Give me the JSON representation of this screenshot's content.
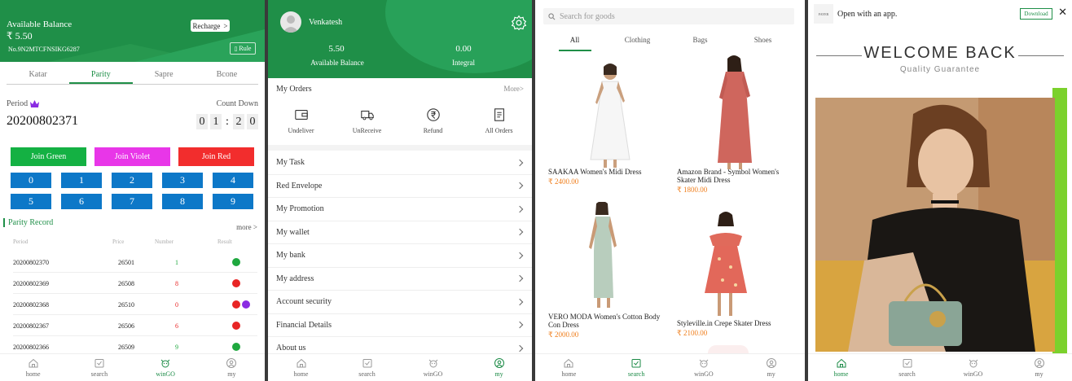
{
  "panel1": {
    "available_balance_label": "Available Balance",
    "balance": "₹ 5.50",
    "account_no": "No.9N2MTCFNSIKG6287",
    "recharge_label": "Recharge",
    "rule_label": "Rule",
    "tabs": [
      "Katar",
      "Parity",
      "Sapre",
      "Bcone"
    ],
    "active_tab": "Parity",
    "period_label": "Period",
    "countdown_label": "Count Down",
    "period_value": "20200802371",
    "countdown": [
      "0",
      "1",
      ":",
      "2",
      "0"
    ],
    "join_buttons": [
      {
        "label": "Join Green",
        "color": "#14b143"
      },
      {
        "label": "Join Violet",
        "color": "#e836e8"
      },
      {
        "label": "Join Red",
        "color": "#f22d2d"
      }
    ],
    "numbers": [
      "0",
      "1",
      "2",
      "3",
      "4",
      "5",
      "6",
      "7",
      "8",
      "9"
    ],
    "record_title": "Parity Record",
    "record_more": "more >",
    "record_headers": [
      "Period",
      "Price",
      "Number",
      "Result"
    ],
    "records": [
      {
        "period": "20200802370",
        "price": "26501",
        "number": "1",
        "num_color": "#1fa83f",
        "results": [
          "#1fa83f"
        ]
      },
      {
        "period": "20200802369",
        "price": "26508",
        "number": "8",
        "num_color": "#e82525",
        "results": [
          "#e82525"
        ]
      },
      {
        "period": "20200802368",
        "price": "26510",
        "number": "0",
        "num_color": "#e82525",
        "results": [
          "#e82525",
          "#8a2be2"
        ]
      },
      {
        "period": "20200802367",
        "price": "26506",
        "number": "6",
        "num_color": "#e82525",
        "results": [
          "#e82525"
        ]
      },
      {
        "period": "20200802366",
        "price": "26509",
        "number": "9",
        "num_color": "#1fa83f",
        "results": [
          "#1fa83f"
        ]
      }
    ],
    "nav": [
      {
        "label": "home",
        "icon": "home-icon",
        "active": false
      },
      {
        "label": "search",
        "icon": "search-icon",
        "active": false
      },
      {
        "label": "winGO",
        "icon": "wingo-icon",
        "active": true
      },
      {
        "label": "my",
        "icon": "my-icon",
        "active": false
      }
    ]
  },
  "panel2": {
    "username": "Venkatesh",
    "balance": "5.50",
    "balance_label": "Available Balance",
    "integral": "0.00",
    "integral_label": "Integral",
    "orders_title": "My Orders",
    "orders_more": "More>",
    "order_icons": [
      {
        "label": "Undeliver",
        "icon": "wallet-icon"
      },
      {
        "label": "UnReceive",
        "icon": "truck-icon"
      },
      {
        "label": "Refund",
        "icon": "rupee-icon"
      },
      {
        "label": "All Orders",
        "icon": "document-icon"
      }
    ],
    "menu": [
      "My Task",
      "Red Envelope",
      "My Promotion",
      "My wallet",
      "My bank",
      "My address",
      "Account security",
      "Financial Details",
      "About us"
    ],
    "nav": [
      {
        "label": "home",
        "icon": "home-icon",
        "active": false
      },
      {
        "label": "search",
        "icon": "search-icon",
        "active": false
      },
      {
        "label": "winGO",
        "icon": "wingo-icon",
        "active": false
      },
      {
        "label": "my",
        "icon": "my-icon",
        "active": true
      }
    ]
  },
  "panel3": {
    "search_placeholder": "Search for goods",
    "tabs": [
      "All",
      "Clothing",
      "Bags",
      "Shoes"
    ],
    "active_tab": "All",
    "products": [
      {
        "name": "SAAKAA Women's Midi Dress",
        "price": "₹ 2400.00",
        "color": "#f2f2f2"
      },
      {
        "name": "Amazon Brand - Symbol Women's Skater Midi Dress",
        "price": "₹ 1800.00",
        "color": "#d0675f"
      },
      {
        "name": "VERO MODA Women's Cotton Body Con Dress",
        "price": "₹ 2000.00",
        "color": "#b8cdbd"
      },
      {
        "name": "Styleville.in Crepe Skater Dress",
        "price": "₹ 2100.00",
        "color": "#e2685a"
      }
    ],
    "nav": [
      {
        "label": "home",
        "icon": "home-icon",
        "active": false
      },
      {
        "label": "search",
        "icon": "search-icon",
        "active": true
      },
      {
        "label": "winGO",
        "icon": "wingo-icon",
        "active": false
      },
      {
        "label": "my",
        "icon": "my-icon",
        "active": false
      }
    ]
  },
  "panel4": {
    "open_with_app": "Open with an app.",
    "logo_text": "FAYER",
    "download_label": "Download",
    "welcome": "WELCOME BACK",
    "quality": "Quality Guarantee",
    "nav": [
      {
        "label": "home",
        "icon": "home-icon",
        "active": true
      },
      {
        "label": "search",
        "icon": "search-icon",
        "active": false
      },
      {
        "label": "winGO",
        "icon": "wingo-icon",
        "active": false
      },
      {
        "label": "my",
        "icon": "my-icon",
        "active": false
      }
    ]
  }
}
